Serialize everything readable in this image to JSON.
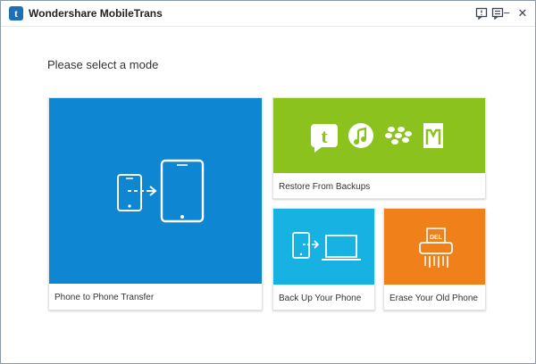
{
  "app": {
    "title": "Wondershare MobileTrans",
    "logo_letter": "t",
    "controls": {
      "feedback_icon": "feedback-icon",
      "menu_icon": "menu-icon",
      "minimize_label": "−",
      "close_label": "✕"
    }
  },
  "main": {
    "prompt": "Please select a mode",
    "tiles": [
      {
        "label": "Phone to Phone Transfer",
        "color": "#0f86d2",
        "icon": "phone-transfer-icon"
      },
      {
        "label": "Restore From Backups",
        "color": "#8cc21e",
        "icon": "backup-sources-icons"
      },
      {
        "label": "Back Up Your Phone",
        "color": "#18b2e2",
        "icon": "phone-to-laptop-icon"
      },
      {
        "label": "Erase Your Old Phone",
        "color": "#f0811a",
        "icon": "shredder-icon",
        "icon_text": "DEL"
      }
    ]
  }
}
